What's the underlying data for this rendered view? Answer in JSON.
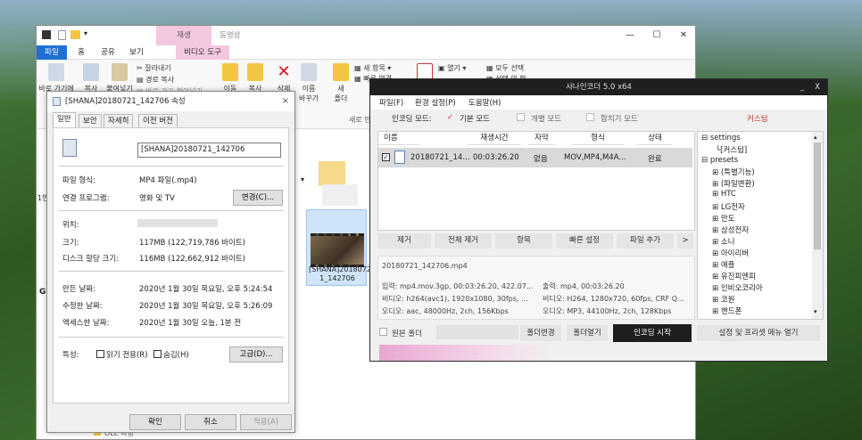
{
  "explorer": {
    "context_tab": "재생",
    "context_tab2": "동영상",
    "ribbon_tabs": [
      "파일",
      "홈",
      "공유",
      "보기",
      "비디오 도구"
    ],
    "buttons": {
      "pin": "바로 가기에",
      "copy": "복사",
      "paste": "붙여넣기",
      "cut": "잘라내기",
      "copy_path": "경로 복사",
      "paste_shortcut": "바로 가기 붙여넣기",
      "move": "이동",
      "copy_to": "복사",
      "delete": "삭제",
      "rename_line1": "이름",
      "rename_line2": "바꾸기",
      "new_folder_line1": "새",
      "new_folder_line2": "폴더",
      "new_item": "새 항목",
      "easy_access": "빠른 연결",
      "open": "열기",
      "select_all": "모두 선택",
      "select_none": "선택 안 함"
    },
    "group_new": "새로 만들기",
    "left_labels": [
      "1연",
      "G"
    ],
    "file_name": "[SHANA]2018072 1_142706",
    "bottom_label": "OLE 바탕"
  },
  "props": {
    "title": "[SHANA]20180721_142706 속성",
    "close": "×",
    "tabs": [
      "일반",
      "보안",
      "자세히",
      "이전 버전"
    ],
    "filename": "[SHANA]20180721_142706",
    "rows": {
      "type_label": "파일 형식:",
      "type_value": "MP4 파일(.mp4)",
      "app_label": "연결 프로그램:",
      "app_value": "영화 및 TV",
      "change_btn": "변경(C)...",
      "loc_label": "위치:",
      "size_label": "크기:",
      "size_value": "117MB (122,719,786 바이트)",
      "disk_label": "디스크 할당 크기:",
      "disk_value": "116MB (122,662,912 바이트)",
      "created_label": "만든 날짜:",
      "created_value": "2020년 1월 30일 목요일, 오후 5:24:54",
      "modified_label": "수정한 날짜:",
      "modified_value": "2020년 1월 30일 목요일, 오후 5:26:09",
      "accessed_label": "액세스한 날짜:",
      "accessed_value": "2020년 1월 30일 오늘, 1분 전",
      "attr_label": "특성:",
      "readonly": "읽기 전용(R)",
      "hidden": "숨김(H)",
      "advanced_btn": "고급(D)..."
    },
    "ok": "확인",
    "cancel": "취소",
    "apply": "적용(A)"
  },
  "encoder": {
    "title": "샤나인코더 5.0 x64",
    "min": "_",
    "close": "X",
    "menu": [
      "파일(F)",
      "환경 설정(P)",
      "도움말(H)"
    ],
    "mode_label": "인코딩 모드:",
    "mode_basic": "기본 모드",
    "mode_individual": "개별 모드",
    "mode_merge": "합치기 모드",
    "custom": "커스텀",
    "columns": [
      "이름",
      "재생시간",
      "자막",
      "형식",
      "상태"
    ],
    "row": {
      "name": "20180721_14...",
      "duration": "00:03:26.20",
      "subtitle": "없음",
      "format": "MOV,MP4,M4A...",
      "status": "완료"
    },
    "buttons": [
      "제거",
      "전체 제거",
      "항목",
      "빠른 설정",
      "파일 추가",
      ">"
    ],
    "info_file": "20180721_142706.mp4",
    "input_line1": "입력: mp4.mov.3gp, 00:03:26.20, 422.07...",
    "input_line2": "비디오: h264(avc1), 1920x1080, 30fps, ...",
    "input_line3": "오디오: aac, 48000Hz, 2ch, 156Kbps",
    "output_line1": "출력: mp4, 00:03:26.20",
    "output_line2": "비디오: H264, 1280x720, 60fps, CRF Q...",
    "output_line3": "오디오: MP3, 44100Hz, 2ch, 128Kbps",
    "tree": [
      "settings",
      "[커스텀]",
      "presets",
      "(특별기능)",
      "(파일변환)",
      "HTC",
      "LG전자",
      "만도",
      "삼성전자",
      "소니",
      "아이리버",
      "애플",
      "유진피엔피",
      "인비오코리아",
      "코원",
      "핸드폰"
    ],
    "source_folder": "원본 폴더",
    "change_folder": "폴더변경",
    "open_folder": "폴더열기",
    "start": "인코딩 시작",
    "settings_menu": "설정 및 프리셋 메뉴 열기",
    "accent": "#1e1e1e",
    "custom_color": "#c0392b"
  }
}
